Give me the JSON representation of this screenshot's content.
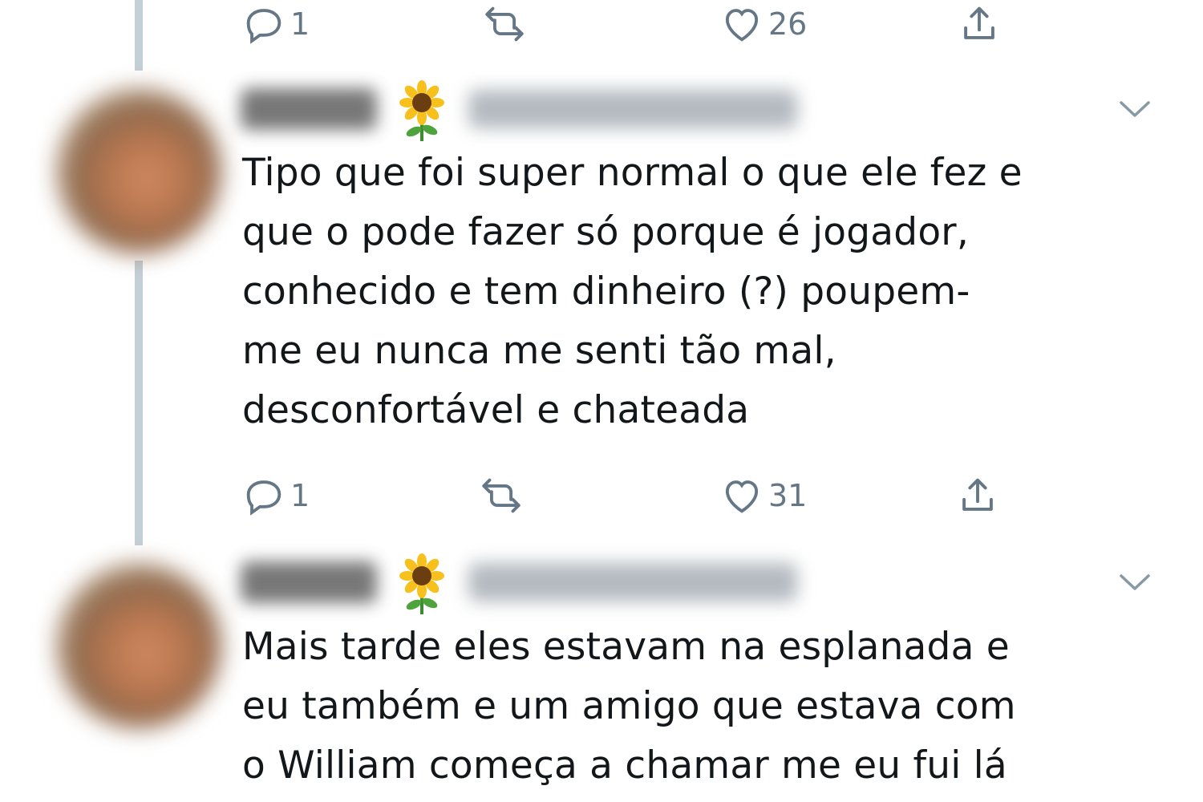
{
  "top_actions": {
    "reply_count": "1",
    "retweet_count": "",
    "like_count": "26"
  },
  "tweets": [
    {
      "text": "Tipo que foi super normal o que ele fez e\nque o pode fazer só porque é jogador,\nconhecido e tem dinheiro (?) poupem-\nme eu nunca me senti tão mal,\ndesconfortável e chateada",
      "emoji": "sunflower",
      "reply_count": "1",
      "retweet_count": "",
      "like_count": "31"
    },
    {
      "text": "Mais tarde eles estavam na esplanada e\neu também e um amigo que estava com\no William começa a chamar me eu fui lá",
      "emoji": "sunflower"
    }
  ],
  "icons": [
    "reply-icon",
    "retweet-icon",
    "like-icon",
    "share-icon",
    "chevron-down-icon",
    "sunflower-icon"
  ],
  "colors": {
    "icon_gray": "#657786",
    "thread_line": "#c4cfd6",
    "text": "#14171a"
  }
}
